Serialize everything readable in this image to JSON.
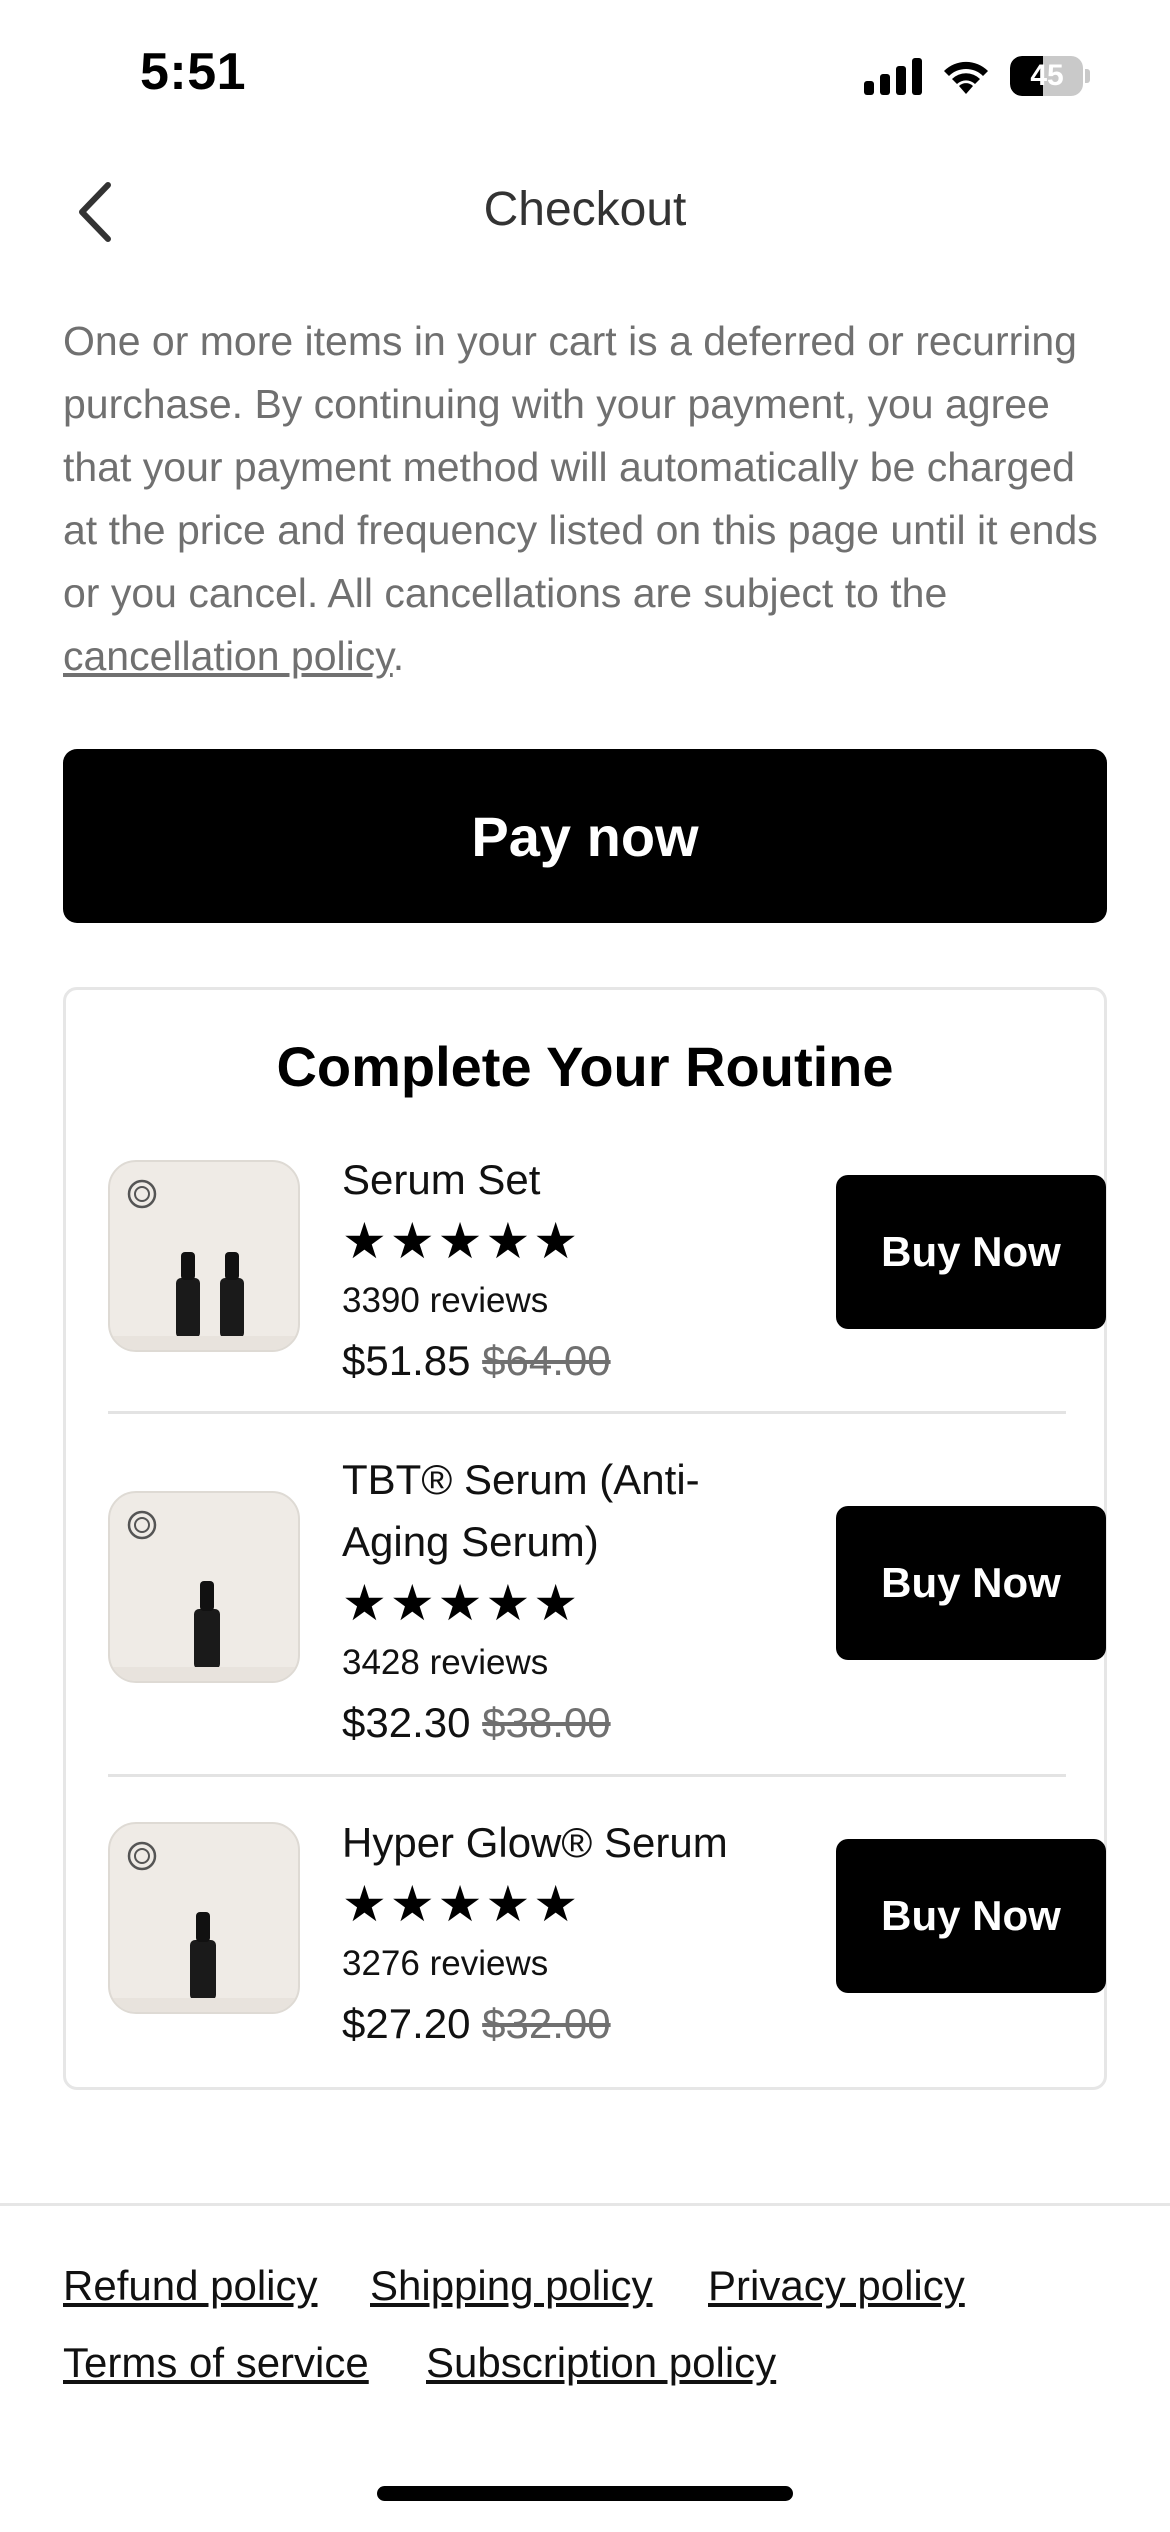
{
  "status_bar": {
    "time": "5:51",
    "battery_level": "45",
    "icons": [
      "signal-icon",
      "wifi-icon",
      "battery-icon"
    ]
  },
  "header": {
    "title": "Checkout",
    "back_icon": "chevron-left-icon"
  },
  "disclaimer": {
    "text": "One or more items in your cart is a deferred or recurring purchase. By continuing with your payment, you agree that your payment method will automatically be charged at the price and frequency listed on this page until it ends or you cancel. All cancellations are subject to the ",
    "link_text": "cancellation policy",
    "suffix": "."
  },
  "pay_button": {
    "label": "Pay now"
  },
  "routine": {
    "title": "Complete Your Routine",
    "products": [
      {
        "name": "Serum Set",
        "rating": 5,
        "stars": "★★★★★",
        "reviews": "3390 reviews",
        "price": "$51.85",
        "original_price": "$64.00",
        "button": "Buy Now",
        "bottle_count": 2
      },
      {
        "name": "TBT® Serum (Anti-Aging Serum)",
        "rating": 5,
        "stars": "★★★★★",
        "reviews": "3428 reviews",
        "price": "$32.30",
        "original_price": "$38.00",
        "button": "Buy Now",
        "bottle_count": 1
      },
      {
        "name": "Hyper Glow® Serum",
        "rating": 5,
        "stars": "★★★★★",
        "reviews": "3276 reviews",
        "price": "$27.20",
        "original_price": "$32.00",
        "button": "Buy Now",
        "bottle_count": 1
      }
    ]
  },
  "footer": {
    "links": [
      "Refund policy",
      "Shipping policy",
      "Privacy policy",
      "Terms of service",
      "Subscription policy"
    ]
  },
  "colors": {
    "primary": "#000000",
    "muted_text": "#707070",
    "thumb_bg": "#efebe6",
    "border": "#e6e6e6"
  }
}
